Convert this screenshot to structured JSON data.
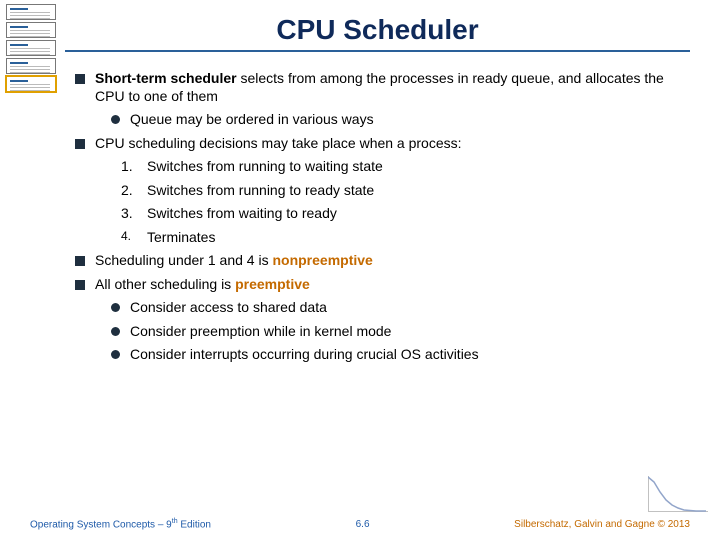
{
  "title": "CPU Scheduler",
  "bullets": {
    "b1a_pre": "Short-term scheduler",
    "b1a_post": " selects from among the processes in ready queue, and allocates the CPU to one of them",
    "b1a_sub1": "Queue may be ordered in various ways",
    "b2": "CPU scheduling decisions may take place when a process:",
    "n1": "Switches from running to waiting state",
    "n2": "Switches from running to ready state",
    "n3": "Switches from waiting to ready",
    "n4": "Terminates",
    "b3_pre": "Scheduling under 1 and 4 is ",
    "b3_accent": "nonpreemptive",
    "b4_pre": "All other scheduling is ",
    "b4_accent": "preemptive",
    "b4_s1": "Consider access to shared data",
    "b4_s2": "Consider preemption while in kernel mode",
    "b4_s3": "Consider interrupts occurring during crucial OS activities"
  },
  "numbers": {
    "n1": "1.",
    "n2": "2.",
    "n3": "3.",
    "n4": "4."
  },
  "footer": {
    "left_pre": "Operating System Concepts – 9",
    "left_sup": "th",
    "left_post": " Edition",
    "center": "6.6",
    "right": "Silberschatz, Galvin and Gagne © 2013"
  },
  "chart_data": {
    "type": "line",
    "x": [
      0,
      1,
      2,
      3,
      4,
      5,
      6,
      7,
      8
    ],
    "values": [
      35,
      30,
      20,
      12,
      7,
      4,
      2,
      1,
      1
    ],
    "title": "",
    "xlabel": "",
    "ylabel": "",
    "ylim": [
      0,
      36
    ]
  }
}
